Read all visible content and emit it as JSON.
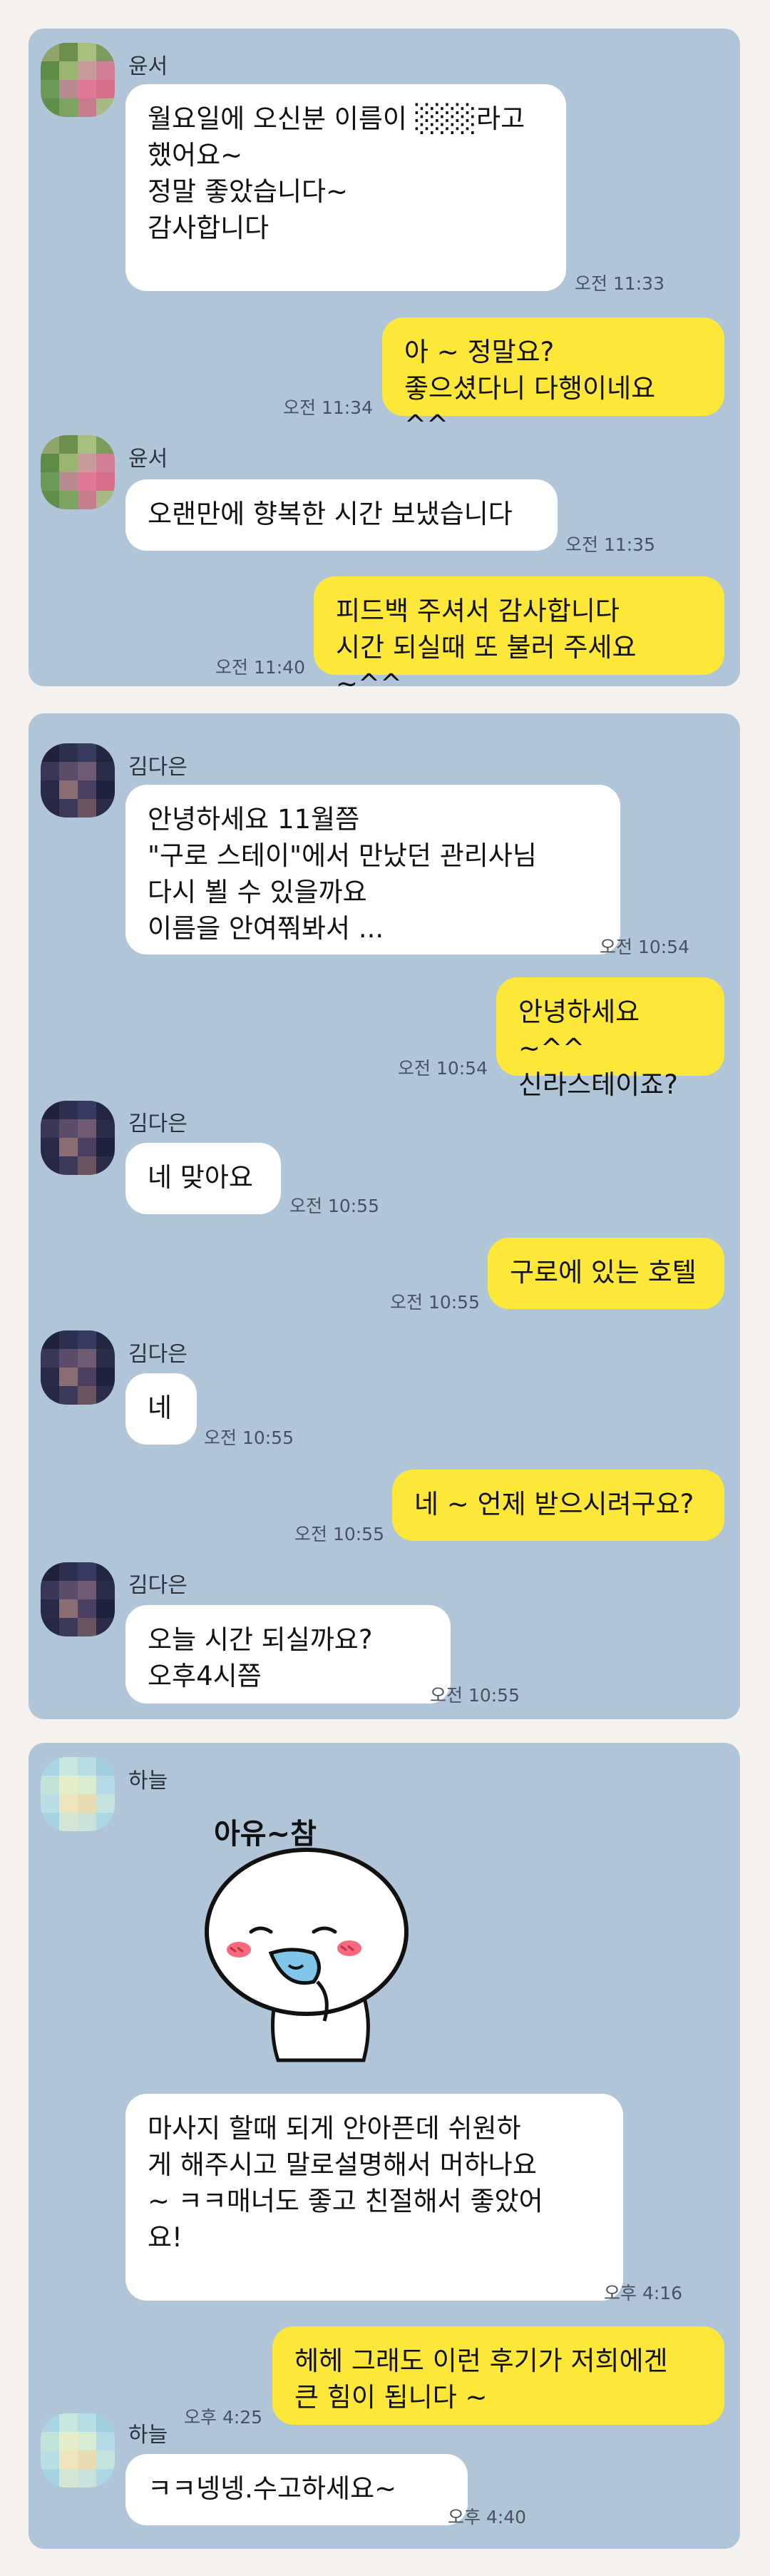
{
  "chats": [
    {
      "contact": "윤서",
      "messages": [
        {
          "from": "them",
          "text": "월요일에 오신분 이름이 ░░░라고\n했어요~\n정말 좋았습니다~\n감사합니다",
          "time": "오전 11:33"
        },
        {
          "from": "me",
          "text": "아 ~ 정말요?\n좋으셨다니 다행이네요 ^^",
          "time": "오전 11:34"
        },
        {
          "from": "them",
          "text": "오랜만에 향복한 시간 보냈습니다",
          "time": "오전 11:35"
        },
        {
          "from": "me",
          "text": "피드백 주셔서 감사합니다\n시간 되실때 또 불러 주세요 ~^^",
          "time": "오전 11:40"
        }
      ]
    },
    {
      "contact": "김다은",
      "messages": [
        {
          "from": "them",
          "text": "안녕하세요 11월쯤\n\"구로 스테이\"에서 만났던 관리사님\n다시 뵐 수 있을까요\n이름을 안여쭤봐서 ...",
          "time": "오전 10:54"
        },
        {
          "from": "me",
          "text": "안녕하세요 ~^^\n신라스테이죠?",
          "time": "오전 10:54"
        },
        {
          "from": "them",
          "text": "네 맞아요",
          "time": "오전 10:55"
        },
        {
          "from": "me",
          "text": "구로에 있는 호텔",
          "time": "오전 10:55"
        },
        {
          "from": "them",
          "text": "네",
          "time": "오전 10:55"
        },
        {
          "from": "me",
          "text": "네 ~ 언제 받으시려구요?",
          "time": "오전 10:55"
        },
        {
          "from": "them",
          "text": "오늘  시간 되실까요?\n오후4시쯤",
          "time": "오전 10:55"
        }
      ]
    },
    {
      "contact": "하늘",
      "sticker_text": "아유~참",
      "messages": [
        {
          "from": "them",
          "text": "마사지 할때 되게 안아픈데 쉬원하\n게 해주시고 말로설명해서 머하나요\n~ ㅋㅋ매너도 좋고 친절해서 좋았어\n요!",
          "time": "오후 4:16"
        },
        {
          "from": "me",
          "text": "헤헤 그래도 이런 후기가 저희에겐\n큰 힘이 됩니다 ~",
          "time": "오후 4:25"
        },
        {
          "from": "them",
          "text": "ㅋㅋ넹넹.수고하세요~",
          "time": "오후 4:40"
        }
      ]
    }
  ],
  "colors": {
    "chat_background": "#b1c5d9",
    "incoming_bubble": "#ffffff",
    "outgoing_bubble": "#fde83a",
    "page_background": "#f4f1ee"
  },
  "icons": [
    "blurred-avatar",
    "sticker-character"
  ]
}
